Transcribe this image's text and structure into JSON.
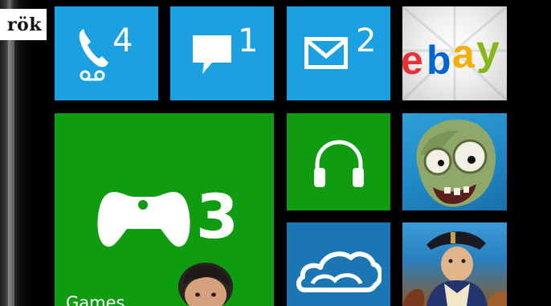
{
  "side_label": "rök",
  "tiles": {
    "phone": {
      "count": "4",
      "icon": "phone-voicemail-icon",
      "color": "#1ba1e2"
    },
    "messaging": {
      "count": "1",
      "icon": "chat-bubble-icon",
      "color": "#1ba1e2"
    },
    "email": {
      "count": "2",
      "icon": "envelope-icon",
      "color": "#1ba1e2"
    },
    "ebay": {
      "text": "ebay",
      "icon": "ebay-logo"
    },
    "games": {
      "count": "3",
      "label": "Games",
      "icon": "controller-icon",
      "color": "#109c10"
    },
    "music": {
      "icon": "headphones-icon",
      "color": "#109c10"
    },
    "plants_vs_zombies": {
      "icon": "zombie-face-icon"
    },
    "skydrive": {
      "icon": "cloud-icon",
      "color": "#1a77b3"
    },
    "age_of_empires": {
      "icon": "napoleon-character-icon"
    }
  }
}
